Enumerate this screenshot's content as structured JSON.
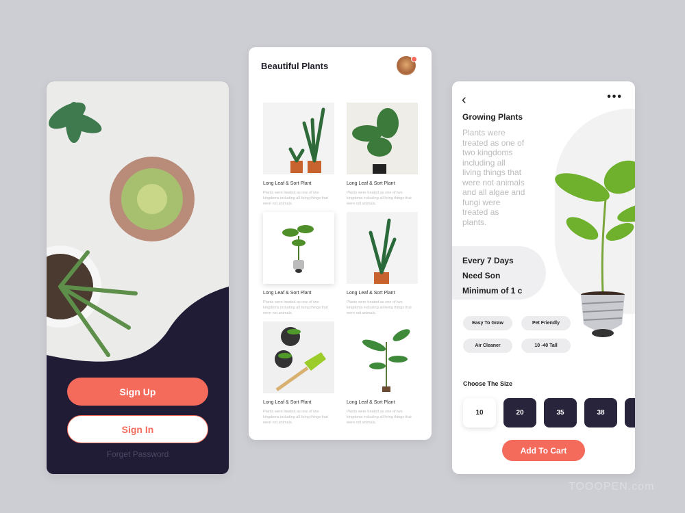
{
  "welcome": {
    "signup": "Sign Up",
    "signin": "Sign In",
    "forget": "Forget Password"
  },
  "list": {
    "title": "Beautiful Plants",
    "items": [
      {
        "name": "Long Leaf & Sort Plant",
        "desc": "Plants were treated as one of two kingdoms including all living things that were not animals."
      },
      {
        "name": "Long Leaf & Sort Plant",
        "desc": "Plants were treated as one of two kingdoms including all living things that were not animals."
      },
      {
        "name": "Long Leaf & Sort Plant",
        "desc": "Plants were treated as one of two kingdoms including all living things that were not animals."
      },
      {
        "name": "Long Leaf & Sort Plant",
        "desc": "Plants were treated as one of two kingdoms including all living things that were not animals."
      },
      {
        "name": "Long Leaf & Sort Plant",
        "desc": "Plants were treated as one of two kingdoms including all living things that were not animals."
      },
      {
        "name": "Long Leaf & Sort Plant",
        "desc": "Plants were treated as one of two kingdoms including all living things that were not animals."
      }
    ]
  },
  "detail": {
    "title": "Growing Plants",
    "desc": "Plants were treated as one of two kingdoms including all living things that were not animals and all algae and fungi were treated as plants.",
    "facts": [
      "Every 7 Days",
      "Need Son",
      "Minimum of 1 c"
    ],
    "tags": [
      "Easy To Graw",
      "Pet Friendly",
      "Air Cleaner",
      "10 -40 Tall"
    ],
    "size_label": "Choose The Size",
    "sizes": [
      "10",
      "20",
      "35",
      "38"
    ],
    "selected_size": "10",
    "cart": "Add To Cart"
  },
  "watermark": "TOOOPEN.com",
  "colors": {
    "accent": "#f46a5b",
    "dark": "#211c35"
  }
}
